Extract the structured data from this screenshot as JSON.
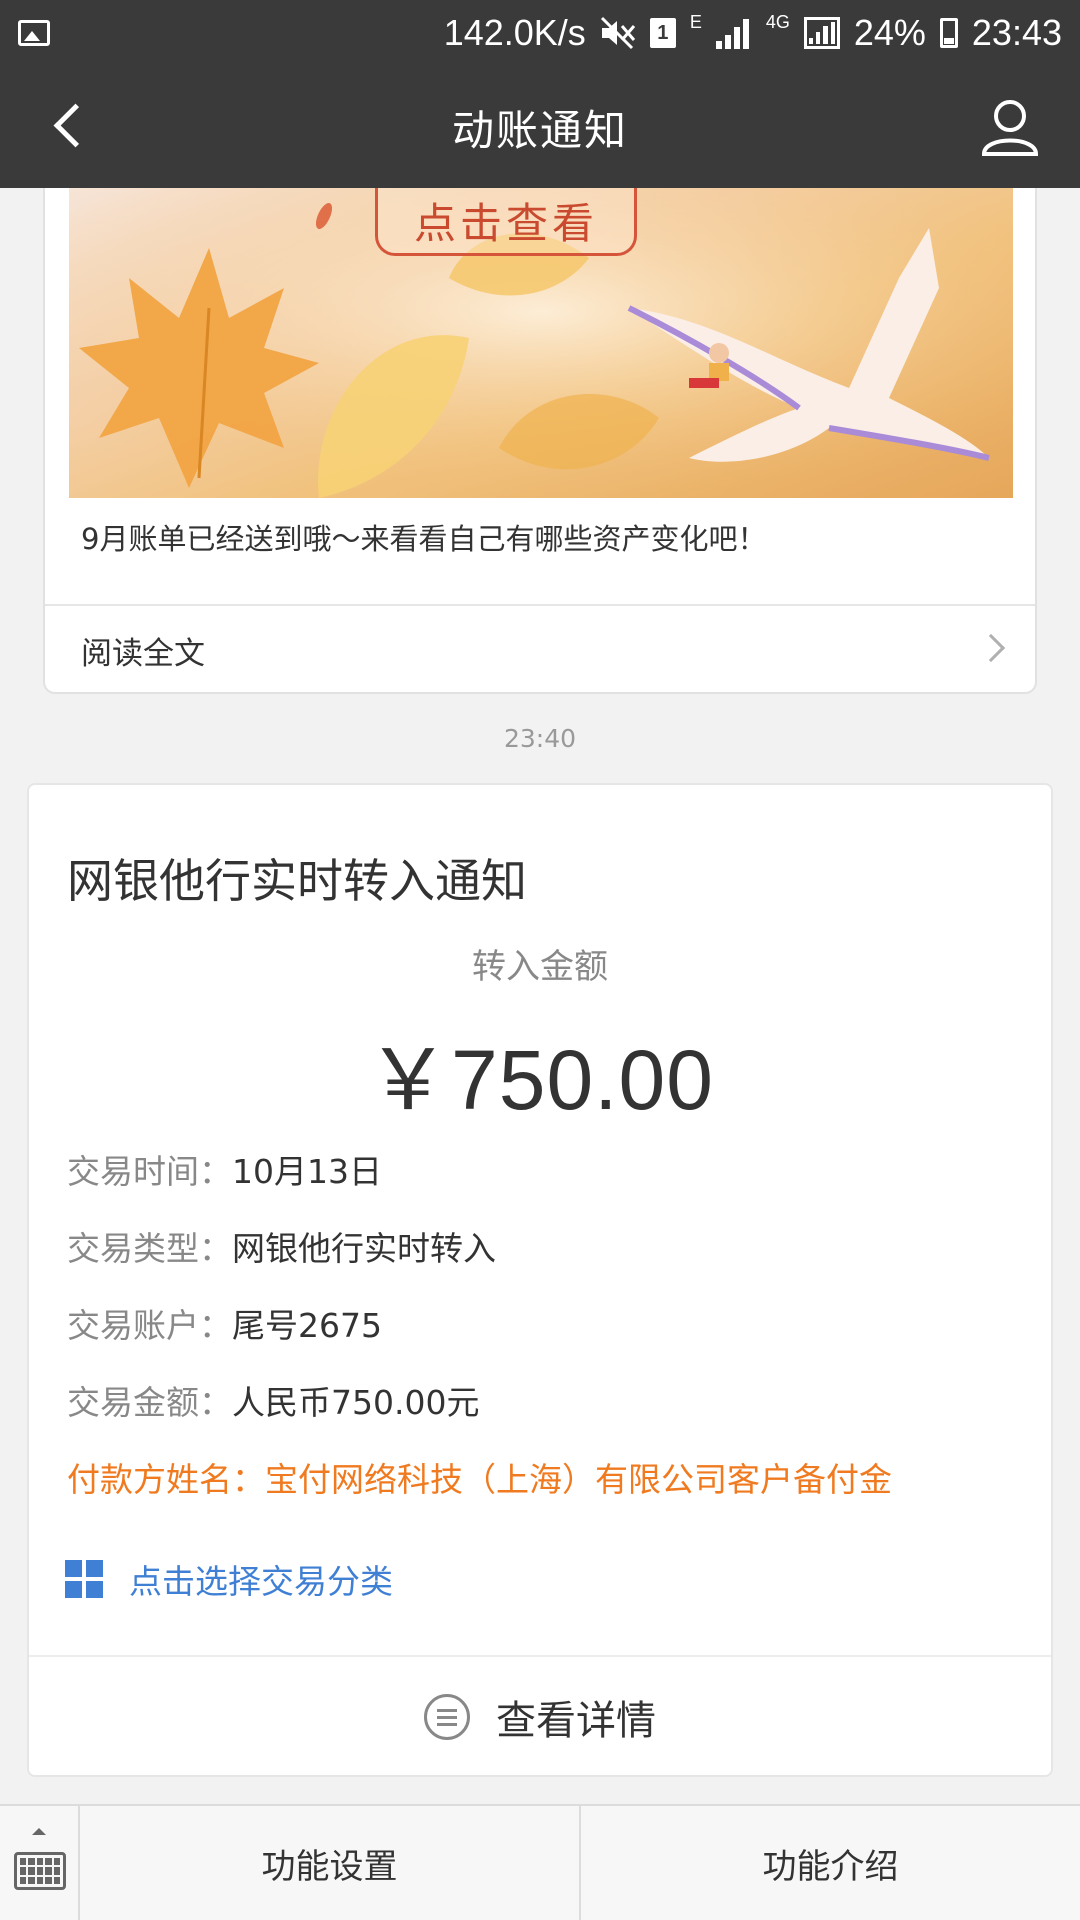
{
  "status_bar": {
    "network_speed": "142.0K/s",
    "sim_slot": "1",
    "network_e": "E",
    "network_4g": "4G",
    "battery": "24%",
    "time": "23:43"
  },
  "nav": {
    "title": "动账通知"
  },
  "article": {
    "banner_button": "点击查看",
    "summary": "9月账单已经送到哦～来看看自己有哪些资产变化吧！",
    "read_more": "阅读全文"
  },
  "timestamp": "23:40",
  "notice": {
    "title": "网银他行实时转入通知",
    "amount_label": "转入金额",
    "amount_value": "￥750.00",
    "details": [
      {
        "key": "交易时间：",
        "value": "10月13日"
      },
      {
        "key": "交易类型：",
        "value": "网银他行实时转入"
      },
      {
        "key": "交易账户：",
        "value": "尾号2675"
      },
      {
        "key": "交易金额：",
        "value": "人民币750.00元"
      }
    ],
    "payer": {
      "key": "付款方姓名：",
      "value": "宝付网络科技（上海）有限公司客户备付金"
    },
    "category_link": "点击选择交易分类",
    "view_detail": "查看详情"
  },
  "bottom_bar": {
    "settings": "功能设置",
    "intro": "功能介绍"
  }
}
